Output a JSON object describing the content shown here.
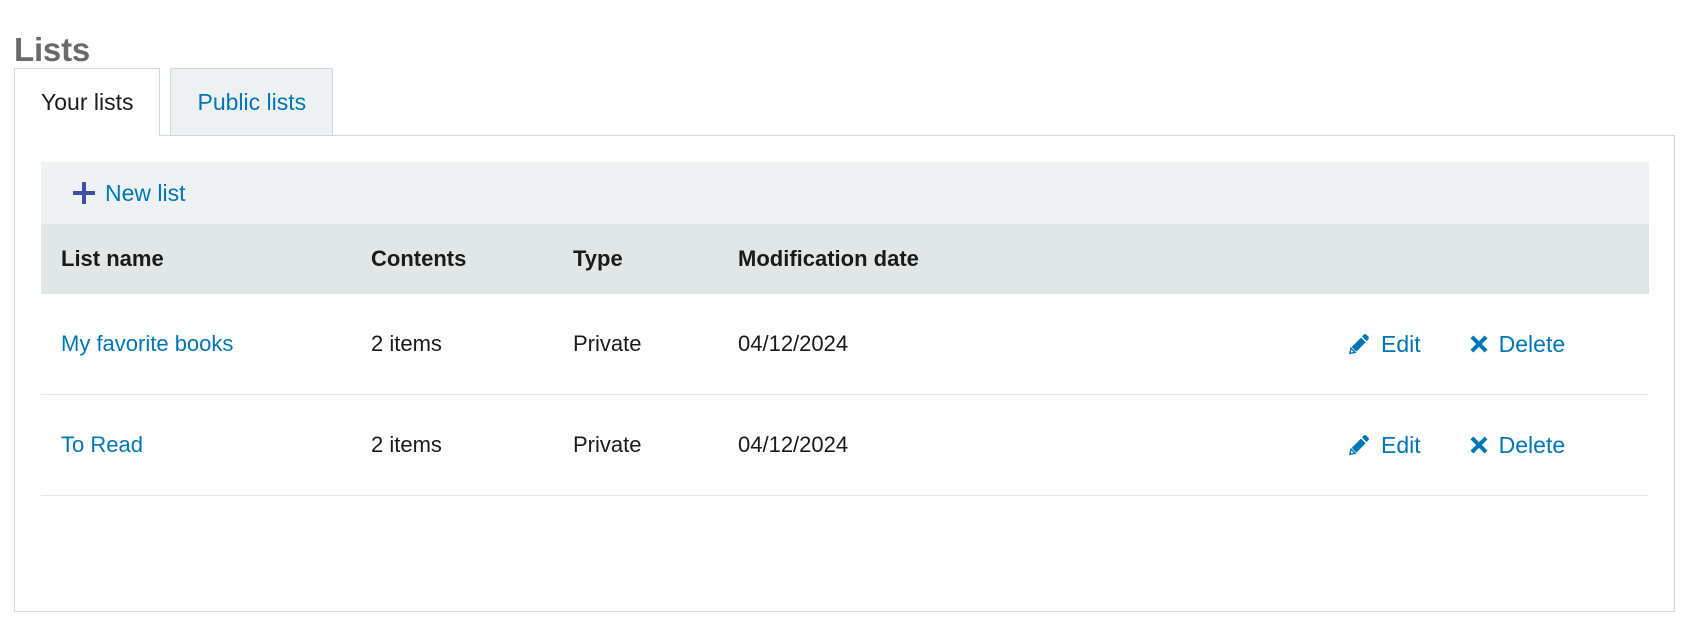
{
  "page": {
    "title": "Lists"
  },
  "tabs": [
    {
      "label": "Your lists",
      "active": true
    },
    {
      "label": "Public lists",
      "active": false
    }
  ],
  "toolbar": {
    "new_list_label": "New list",
    "new_list_icon": "plus-icon"
  },
  "table": {
    "columns": [
      "List name",
      "Contents",
      "Type",
      "Modification date",
      ""
    ],
    "rows": [
      {
        "name": "My favorite books",
        "contents": "2 items",
        "type": "Private",
        "modification_date": "04/12/2024",
        "edit_label": "Edit",
        "delete_label": "Delete"
      },
      {
        "name": "To Read",
        "contents": "2 items",
        "type": "Private",
        "modification_date": "04/12/2024",
        "edit_label": "Edit",
        "delete_label": "Delete"
      }
    ]
  },
  "colors": {
    "link": "#0076b6",
    "title": "#6a6a6a",
    "toolbar_bg": "#eef2f2",
    "header_bg": "#e1e6e6",
    "border": "#d2d8d8",
    "plus": "#3f51a5"
  }
}
